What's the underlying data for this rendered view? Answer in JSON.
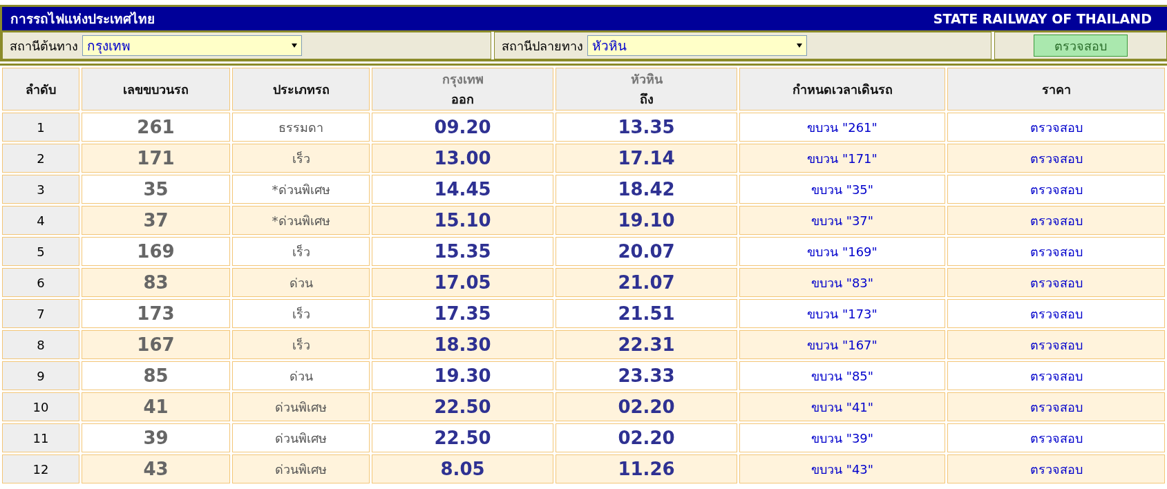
{
  "header": {
    "title": "การรถไฟแห่งประเทศไทย",
    "title_en": "STATE RAILWAY OF THAILAND"
  },
  "search": {
    "origin": {
      "label": "สถานีต้นทาง",
      "value": "กรุงเทพ"
    },
    "destination": {
      "label": "สถานีปลายทาง",
      "value": "หัวหิน"
    },
    "button": "ตรวจสอบ"
  },
  "table": {
    "columns": [
      {
        "label": "ลำดับ"
      },
      {
        "label": "เลขขบวนรถ"
      },
      {
        "label": "ประเภทรถ"
      },
      {
        "station": "กรุงเทพ",
        "label": "ออก"
      },
      {
        "station": "หัวหิน",
        "label": "ถึง"
      },
      {
        "label": "กำหนดเวลาเดินรถ"
      },
      {
        "label": "ราคา"
      }
    ],
    "rows": [
      {
        "no": "1",
        "train": "261",
        "type": "ธรรมดา",
        "depart": "09.20",
        "arrive": "13.35",
        "schedule": "ขบวน \"261\"",
        "price": "ตรวจสอบ"
      },
      {
        "no": "2",
        "train": "171",
        "type": "เร็ว",
        "depart": "13.00",
        "arrive": "17.14",
        "schedule": "ขบวน \"171\"",
        "price": "ตรวจสอบ"
      },
      {
        "no": "3",
        "train": "35",
        "type": "*ด่วนพิเศษ",
        "depart": "14.45",
        "arrive": "18.42",
        "schedule": "ขบวน \"35\"",
        "price": "ตรวจสอบ"
      },
      {
        "no": "4",
        "train": "37",
        "type": "*ด่วนพิเศษ",
        "depart": "15.10",
        "arrive": "19.10",
        "schedule": "ขบวน \"37\"",
        "price": "ตรวจสอบ"
      },
      {
        "no": "5",
        "train": "169",
        "type": "เร็ว",
        "depart": "15.35",
        "arrive": "20.07",
        "schedule": "ขบวน \"169\"",
        "price": "ตรวจสอบ"
      },
      {
        "no": "6",
        "train": "83",
        "type": "ด่วน",
        "depart": "17.05",
        "arrive": "21.07",
        "schedule": "ขบวน \"83\"",
        "price": "ตรวจสอบ"
      },
      {
        "no": "7",
        "train": "173",
        "type": "เร็ว",
        "depart": "17.35",
        "arrive": "21.51",
        "schedule": "ขบวน \"173\"",
        "price": "ตรวจสอบ"
      },
      {
        "no": "8",
        "train": "167",
        "type": "เร็ว",
        "depart": "18.30",
        "arrive": "22.31",
        "schedule": "ขบวน \"167\"",
        "price": "ตรวจสอบ"
      },
      {
        "no": "9",
        "train": "85",
        "type": "ด่วน",
        "depart": "19.30",
        "arrive": "23.33",
        "schedule": "ขบวน \"85\"",
        "price": "ตรวจสอบ"
      },
      {
        "no": "10",
        "train": "41",
        "type": "ด่วนพิเศษ",
        "depart": "22.50",
        "arrive": "02.20",
        "schedule": "ขบวน \"41\"",
        "price": "ตรวจสอบ"
      },
      {
        "no": "11",
        "train": "39",
        "type": "ด่วนพิเศษ",
        "depart": "22.50",
        "arrive": "02.20",
        "schedule": "ขบวน \"39\"",
        "price": "ตรวจสอบ"
      },
      {
        "no": "12",
        "train": "43",
        "type": "ด่วนพิเศษ",
        "depart": "8.05",
        "arrive": "11.26",
        "schedule": "ขบวน \"43\"",
        "price": "ตรวจสอบ"
      }
    ]
  }
}
